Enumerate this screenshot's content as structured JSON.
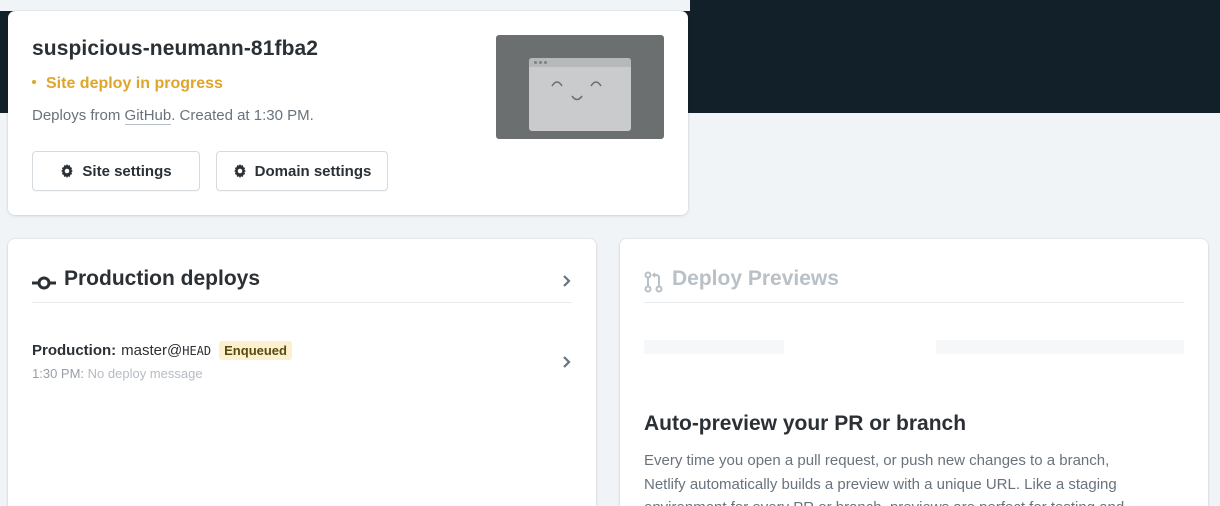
{
  "site": {
    "name": "suspicious-neumann-81fba2",
    "status": "Site deploy in progress",
    "meta_prefix": "Deploys from ",
    "meta_link": "GitHub",
    "meta_suffix": ". Created at 1:30 PM.",
    "buttons": {
      "site_settings": "Site settings",
      "domain_settings": "Domain settings"
    }
  },
  "production": {
    "title": "Production deploys",
    "deploy": {
      "label": "Production:",
      "branch": "master@",
      "ref": "HEAD",
      "badge": "Enqueued",
      "time": "1:30 PM:",
      "message": "No deploy message"
    }
  },
  "previews": {
    "title": "Deploy Previews",
    "heading": "Auto-preview your PR or branch",
    "description": "Every time you open a pull request, or push new changes to a branch, Netlify automatically builds a preview with a unique URL. Like a staging environment for every PR or branch, previews are perfect for testing and"
  },
  "colors": {
    "header_bg": "#12202a",
    "status": "#dfa52a",
    "badge_bg": "#fbf1cf"
  },
  "icons": [
    "gear-icon",
    "commit-icon",
    "chevron-right-icon",
    "pull-request-icon"
  ]
}
